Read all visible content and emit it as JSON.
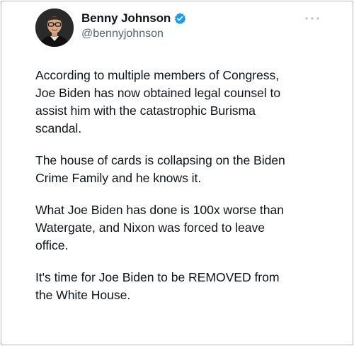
{
  "author": {
    "display_name": "Benny Johnson",
    "handle": "@bennyjohnson",
    "verified": true,
    "verified_color": "#1d9bf0",
    "avatar_icon": "profile-photo"
  },
  "menu": {
    "icon": "more-horizontal-icon"
  },
  "tweet": {
    "paragraphs": [
      "According to multiple members of Congress,\nJoe Biden has now obtained legal counsel to\nassist him with the catastrophic Burisma\nscandal.",
      "The house of cards is collapsing on the Biden\nCrime Family and he knows it.",
      "What Joe Biden has done is 100x worse than\nWatergate, and Nixon was forced to leave\noffice.",
      "It's time for Joe Biden to be REMOVED from\nthe White House."
    ]
  },
  "colors": {
    "text_primary": "#0f1419",
    "text_secondary": "#536471",
    "border": "#b9b9b9",
    "background": "#ffffff"
  }
}
